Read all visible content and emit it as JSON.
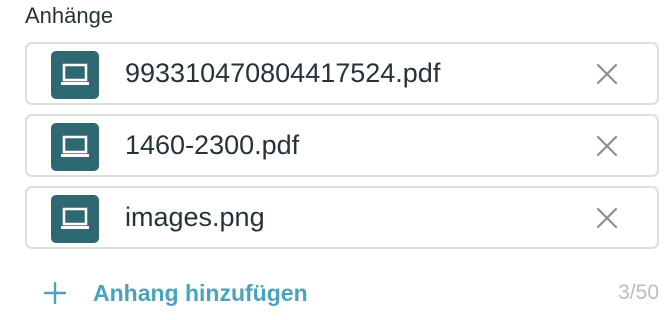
{
  "section": {
    "title": "Anhänge"
  },
  "attachments": [
    {
      "name": "993310470804417524.pdf",
      "icon": "computer-icon"
    },
    {
      "name": "1460-2300.pdf",
      "icon": "computer-icon"
    },
    {
      "name": "images.png",
      "icon": "computer-icon"
    }
  ],
  "remove_icon": "close-icon",
  "add_attachment": {
    "label": "Anhang hinzufügen",
    "icon": "plus-icon"
  },
  "counter": "3/50",
  "colors": {
    "icon_bg": "#2e6872",
    "accent": "#4aa3bc",
    "border": "#dcdfe1",
    "text": "#26343a",
    "muted": "#b8bec2"
  }
}
